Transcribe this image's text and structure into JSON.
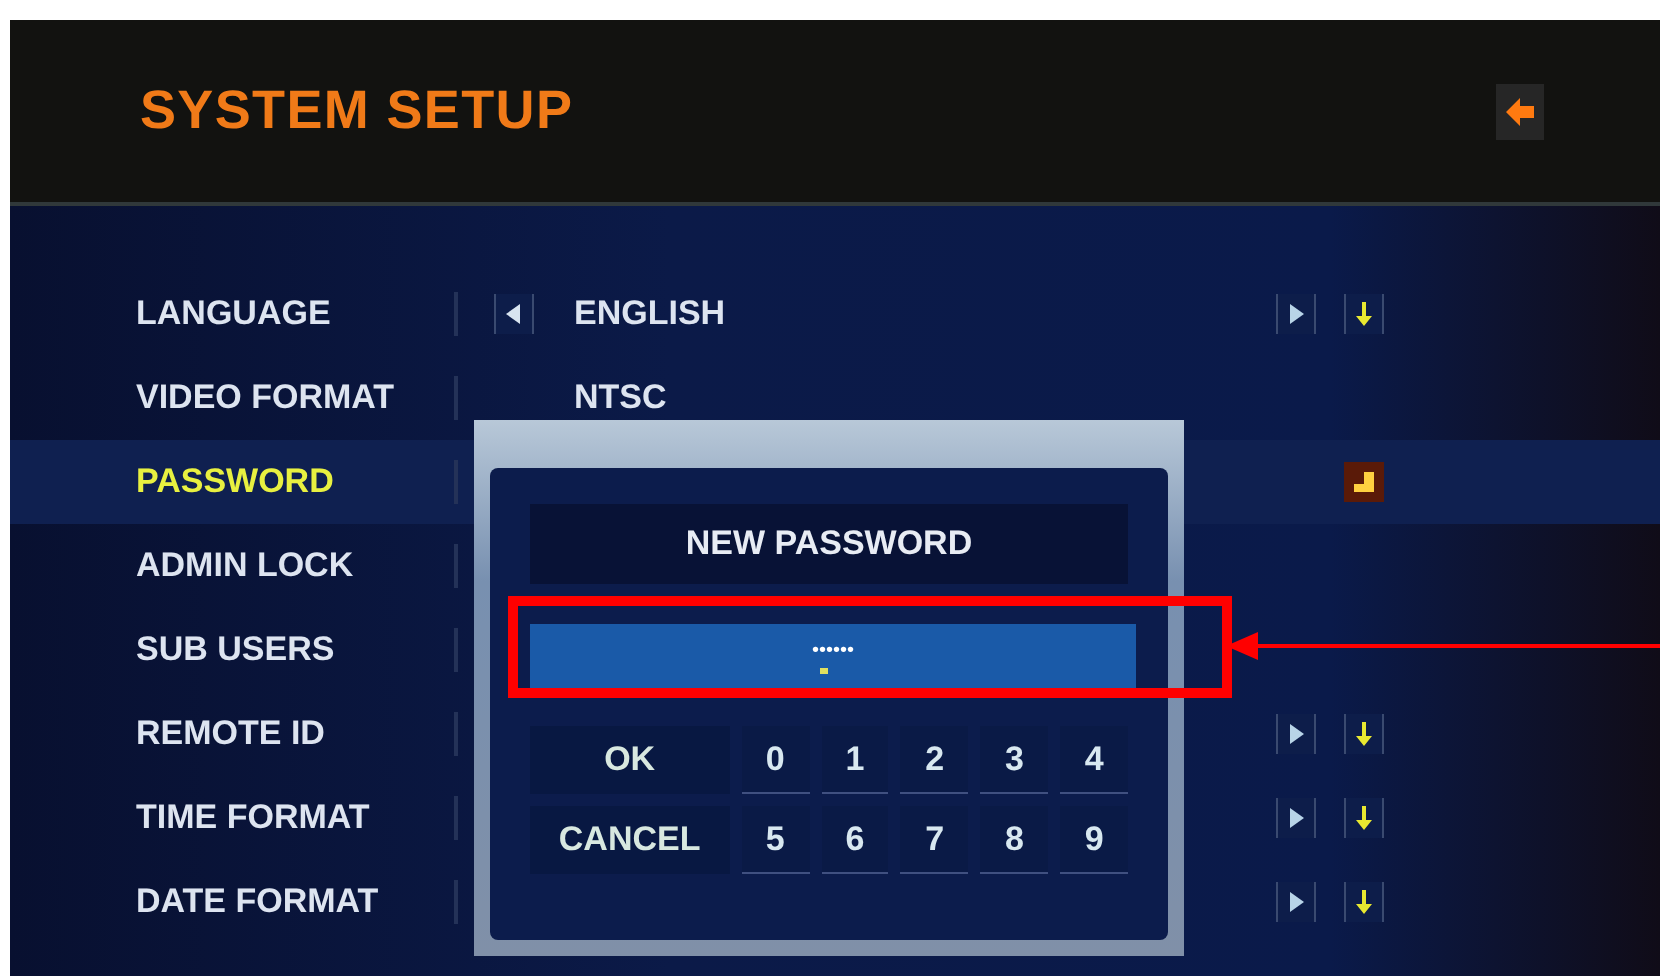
{
  "header": {
    "title": "SYSTEM SETUP"
  },
  "settings": [
    {
      "label": "LANGUAGE",
      "value": "ENGLISH",
      "selected": false,
      "kind": "select",
      "prev_button": true
    },
    {
      "label": "VIDEO FORMAT",
      "value": "NTSC",
      "selected": false,
      "kind": "plain",
      "prev_button": false
    },
    {
      "label": "PASSWORD",
      "selected": true,
      "kind": "enter",
      "prev_button": false
    },
    {
      "label": "ADMIN LOCK",
      "selected": false,
      "kind": "plain",
      "prev_button": false
    },
    {
      "label": "SUB USERS",
      "selected": false,
      "kind": "plain",
      "prev_button": false
    },
    {
      "label": "REMOTE ID",
      "selected": false,
      "kind": "select",
      "prev_button": false
    },
    {
      "label": "TIME FORMAT",
      "selected": false,
      "kind": "select",
      "prev_button": false
    },
    {
      "label": "DATE FORMAT",
      "selected": false,
      "kind": "select",
      "prev_button": false
    }
  ],
  "dialog": {
    "title": "NEW PASSWORD",
    "field": {
      "value": "••••••"
    },
    "buttons": [
      {
        "label": "OK"
      },
      {
        "label": "CANCEL"
      }
    ],
    "keypad": [
      [
        "0",
        "1",
        "2",
        "3",
        "4"
      ],
      [
        "5",
        "6",
        "7",
        "8",
        "9"
      ]
    ]
  },
  "annotation": {
    "kind": "box-arrow"
  }
}
